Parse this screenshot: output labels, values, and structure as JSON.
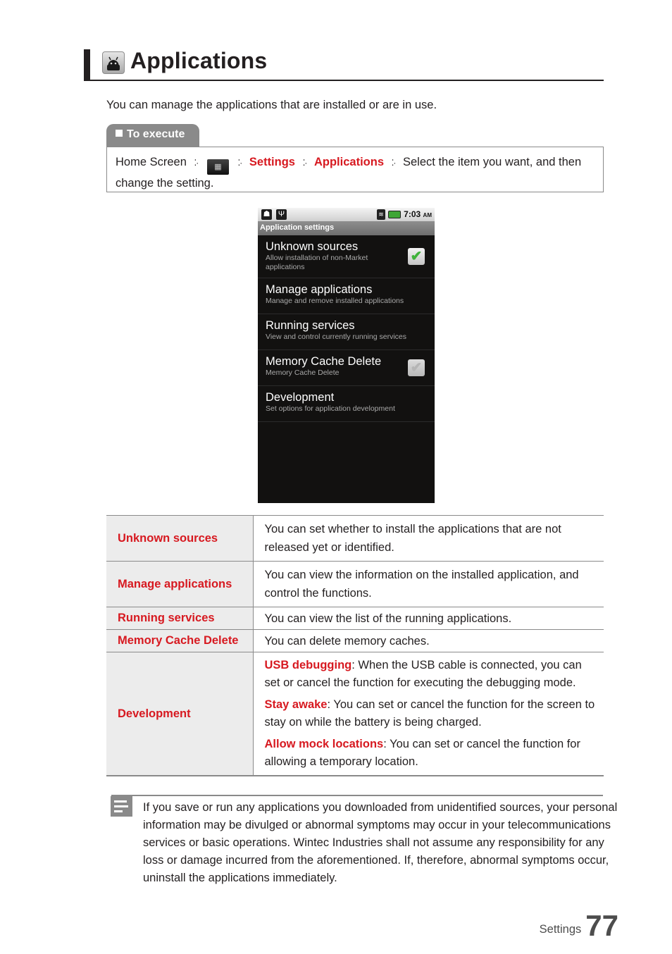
{
  "heading": {
    "icon": "android-applications-icon",
    "title": "Applications"
  },
  "intro": "You can manage the applications that are installed or are in use.",
  "execute": {
    "tab_label": "To execute",
    "path": [
      {
        "text": "Home Screen",
        "style": "plain"
      },
      {
        "icon": "app-drawer-grid-icon"
      },
      {
        "text": "Settings",
        "style": "red"
      },
      {
        "text": "Applications",
        "style": "red"
      }
    ],
    "tail": "Select the item you want, and then change the setting."
  },
  "phone": {
    "status_bar": {
      "left_icons": [
        "android-debug-icon",
        "usb-icon"
      ],
      "right_icons": [
        "wifi-signal-icon",
        "battery-charging-icon"
      ],
      "time": "7:03",
      "ampm": "AM"
    },
    "screen_title": "Application settings",
    "items": [
      {
        "title": "Unknown sources",
        "summary": "Allow installation of non-Market applications",
        "checkbox": "checked"
      },
      {
        "title": "Manage applications",
        "summary": "Manage and remove installed applications",
        "checkbox": null
      },
      {
        "title": "Running services",
        "summary": "View and control currently running services",
        "checkbox": null
      },
      {
        "title": "Memory Cache Delete",
        "summary": "Memory Cache Delete",
        "checkbox": "disabled"
      },
      {
        "title": "Development",
        "summary": "Set options for application development",
        "checkbox": null
      }
    ]
  },
  "table": {
    "rows": [
      {
        "key": "Unknown sources",
        "value": "You can set whether to install the applications that are not released yet or identified."
      },
      {
        "key": "Manage applications",
        "value": "You can view the information on the installed application, and control the functions."
      },
      {
        "key": "Running services",
        "value": "You can view the list of the running applications."
      },
      {
        "key": "Memory Cache Delete",
        "value": "You can delete memory caches."
      },
      {
        "key": "Development",
        "items": [
          {
            "term": "USB debugging",
            "desc": ": When the USB cable is connected, you can set or cancel the function for executing the debugging mode."
          },
          {
            "term": "Stay awake",
            "desc": ": You can set or cancel the function for the screen to stay on while the battery is being charged."
          },
          {
            "term": "Allow mock locations",
            "desc": ": You can set or cancel the function for allowing a temporary location."
          }
        ]
      }
    ]
  },
  "note": {
    "icon": "note-icon",
    "text": "If you save or run any applications you downloaded from unidentified sources, your personal information may be divulged or abnormal symptoms may occur in your telecommunications services or basic operations. Wintec Industries shall not assume any responsibility for any loss or damage incurred from the aforementioned. If, therefore, abnormal symptoms occur, uninstall the applications immediately."
  },
  "footer": {
    "section": "Settings",
    "page": "77"
  },
  "colors": {
    "accent_red": "#d71920",
    "tab_gray": "#8a8a8a",
    "key_cell_bg": "#ececec"
  }
}
